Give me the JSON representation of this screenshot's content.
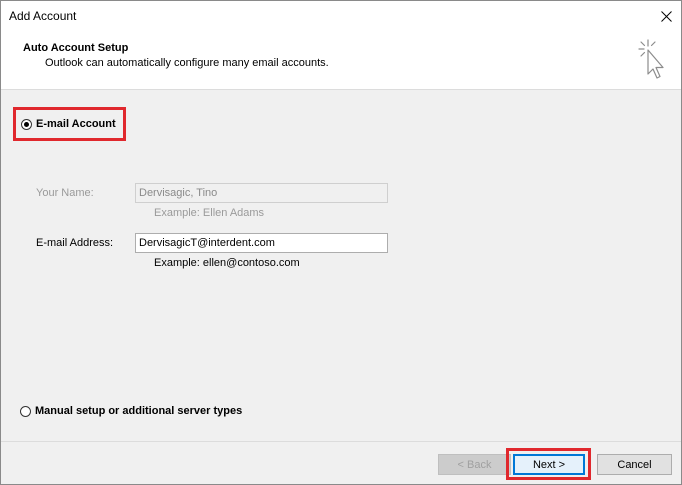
{
  "window": {
    "title": "Add Account"
  },
  "header": {
    "title": "Auto Account Setup",
    "subtitle": "Outlook can automatically configure many email accounts."
  },
  "options": {
    "email_account_label": "E-mail Account",
    "manual_setup_label": "Manual setup or additional server types",
    "selected": "E-mail Account"
  },
  "form": {
    "name_label": "Your Name:",
    "name_value": "Dervisagic, Tino",
    "name_example": "Example: Ellen Adams",
    "email_label": "E-mail Address:",
    "email_value": "DervisagicT@interdent.com",
    "email_example": "Example: ellen@contoso.com"
  },
  "buttons": {
    "back": "< Back",
    "next": "Next >",
    "cancel": "Cancel"
  },
  "colors": {
    "highlight": "#e0282d",
    "default_button_border": "#0078d7"
  },
  "icons": {
    "close": "close-icon",
    "header": "sparkle-cursor-icon"
  }
}
